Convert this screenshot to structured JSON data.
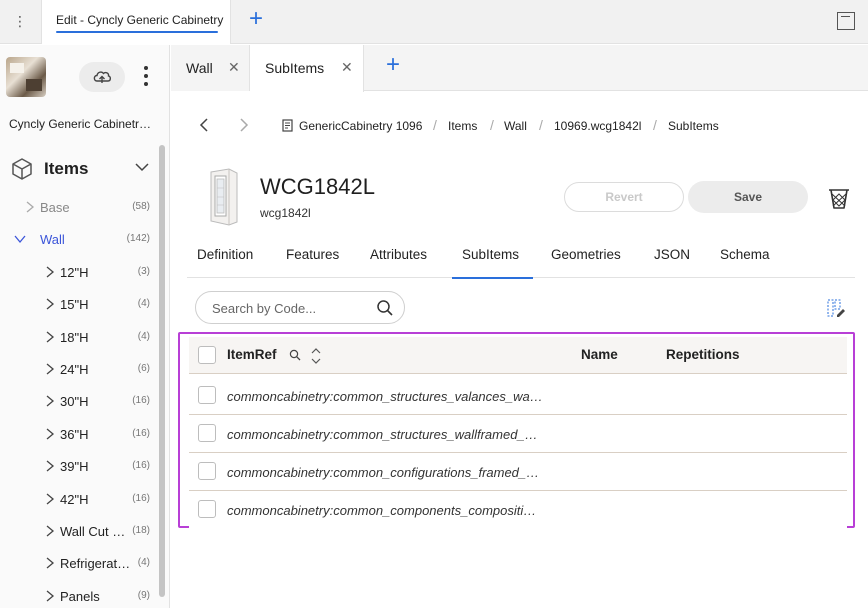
{
  "top": {
    "tab_label": "Edit - Cyncly Generic Cabinetry",
    "add_tab": "+",
    "menu_icon": "vertical-dots-icon",
    "window_icon": "window-icon"
  },
  "sidebar": {
    "project_name": "Cyncly Generic Cabinetr…",
    "items_label": "Items",
    "tree": [
      {
        "label": "Base",
        "count": "(58)",
        "level": 0,
        "expanded": false,
        "muted": true
      },
      {
        "label": "Wall",
        "count": "(142)",
        "level": 0,
        "expanded": true,
        "selected": true
      },
      {
        "label": "12\"H",
        "count": "(3)",
        "level": 1
      },
      {
        "label": "15\"H",
        "count": "(4)",
        "level": 1
      },
      {
        "label": "18\"H",
        "count": "(4)",
        "level": 1
      },
      {
        "label": "24\"H",
        "count": "(6)",
        "level": 1
      },
      {
        "label": "30\"H",
        "count": "(16)",
        "level": 1
      },
      {
        "label": "36\"H",
        "count": "(16)",
        "level": 1
      },
      {
        "label": "39\"H",
        "count": "(16)",
        "level": 1
      },
      {
        "label": "42\"H",
        "count": "(16)",
        "level": 1
      },
      {
        "label": "Wall Cut …",
        "count": "(18)",
        "level": 1
      },
      {
        "label": "Refrigerat…",
        "count": "(4)",
        "level": 1
      },
      {
        "label": "Panels",
        "count": "(9)",
        "level": 1
      }
    ]
  },
  "main_tabs": [
    {
      "label": "Wall",
      "active": false
    },
    {
      "label": "SubItems",
      "active": true
    }
  ],
  "breadcrumb": [
    "GenericCabinetry 1096",
    "Items",
    "Wall",
    "10969.wcg1842l",
    "SubItems"
  ],
  "item": {
    "code": "WCG1842L",
    "subcode": "wcg1842l",
    "revert_label": "Revert",
    "save_label": "Save"
  },
  "detail_tabs": [
    "Definition",
    "Features",
    "Attributes",
    "SubItems",
    "Geometries",
    "JSON",
    "Schema"
  ],
  "active_detail_tab": "SubItems",
  "search": {
    "placeholder": "Search by Code...",
    "value": ""
  },
  "table": {
    "columns": [
      "ItemRef",
      "Name",
      "Repetitions"
    ],
    "rows": [
      {
        "item_ref": "commoncabinetry:common_structures_valances_wa…",
        "name": "",
        "repetitions": ""
      },
      {
        "item_ref": "commoncabinetry:common_structures_wallframed_…",
        "name": "",
        "repetitions": ""
      },
      {
        "item_ref": "commoncabinetry:common_configurations_framed_…",
        "name": "",
        "repetitions": ""
      },
      {
        "item_ref": "commoncabinetry:common_components_compositi…",
        "name": "",
        "repetitions": ""
      }
    ]
  },
  "colors": {
    "accent": "#2a6fdb",
    "highlight_frame": "#b83fd6",
    "tree_selected": "#3b55d9"
  }
}
